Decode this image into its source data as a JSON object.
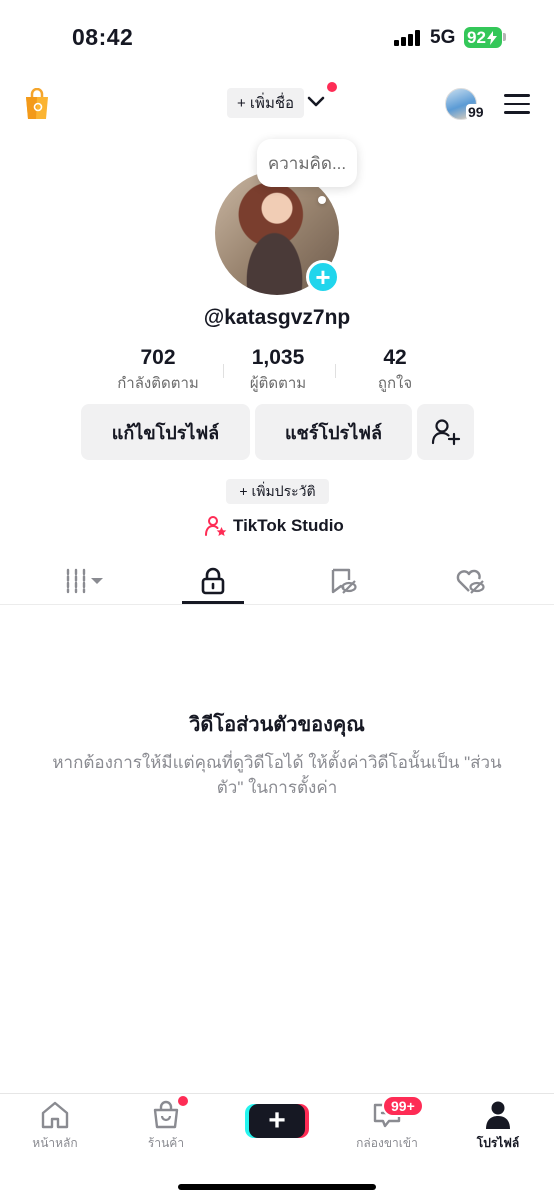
{
  "status_bar": {
    "time": "08:42",
    "network": "5G",
    "battery": "92"
  },
  "header": {
    "add_name_label": "+ เพิ่มชื่อ",
    "story_count": "99"
  },
  "profile": {
    "thought_bubble": "ความคิด...",
    "avatar_add": "+",
    "username": "@katasgvz7np",
    "stats": [
      {
        "value": "702",
        "label": "กำลังติดตาม"
      },
      {
        "value": "1,035",
        "label": "ผู้ติดตาม"
      },
      {
        "value": "42",
        "label": "ถูกใจ"
      }
    ],
    "edit_profile_label": "แก้ไขโปรไฟล์",
    "share_profile_label": "แชร์โปรไฟล์",
    "add_bio_label": "+ เพิ่มประวัติ",
    "studio_label": "TikTok Studio"
  },
  "tabs": {
    "active": "private",
    "icons": [
      "grid-icon",
      "lock-icon",
      "bookmark-icon",
      "heart-icon"
    ]
  },
  "empty_state": {
    "title": "วิดีโอส่วนตัวของคุณ",
    "description": "หากต้องการให้มีแต่คุณที่ดูวิดีโอได้ ให้ตั้งค่าวิดีโอนั้นเป็น \"ส่วนตัว\" ในการตั้งค่า"
  },
  "bottom_nav": {
    "items": [
      {
        "label": "หน้าหลัก"
      },
      {
        "label": "ร้านค้า"
      },
      {
        "label": "+"
      },
      {
        "label": "กล่องขาเข้า"
      },
      {
        "label": "โปรไฟล์"
      }
    ],
    "inbox_badge": "99+"
  },
  "colors": {
    "accent": "#fe2c55",
    "cyan": "#25f4ee",
    "add_button": "#20d5ec",
    "battery": "#34c759"
  }
}
